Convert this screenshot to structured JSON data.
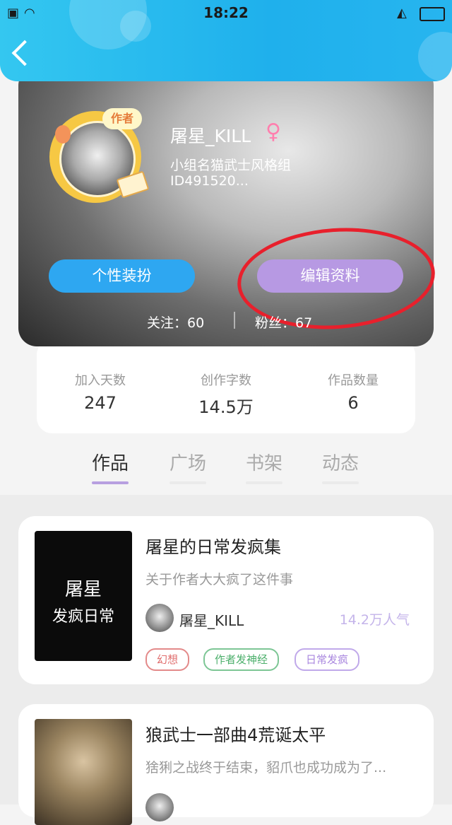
{
  "status_bar": {
    "time": "18:22"
  },
  "profile": {
    "username": "屠星_KILL",
    "gender_symbol": "♀",
    "avatar_badge": "作者",
    "group": "小组名猫武士风格组",
    "id_text": "ID491520...",
    "dress_button": "个性装扮",
    "edit_button": "编辑资料",
    "follow_text": "关注：60",
    "fans_text": "粉丝：67"
  },
  "stats": [
    {
      "label": "加入天数",
      "value": "247"
    },
    {
      "label": "创作字数",
      "value": "14.5万"
    },
    {
      "label": "作品数量",
      "value": "6"
    }
  ],
  "tabs": [
    "作品",
    "广场",
    "书架",
    "动态"
  ],
  "works": [
    {
      "cover_line1": "屠星",
      "cover_line2": "发疯日常",
      "title": "屠星的日常发疯集",
      "desc": "关于作者大大疯了这件事",
      "author": "屠星_KILL",
      "popularity": "14.2万人气",
      "tags": [
        "幻想",
        "作者发神经",
        "日常发疯"
      ]
    },
    {
      "title": "狼武士一部曲4荒诞太平",
      "desc": "猞猁之战终于结束，貂爪也成功成为了..."
    }
  ],
  "colors": {
    "accent_blue": "#2ea7f1",
    "accent_purple": "#b799e3",
    "annotation_red": "#e8202c"
  }
}
